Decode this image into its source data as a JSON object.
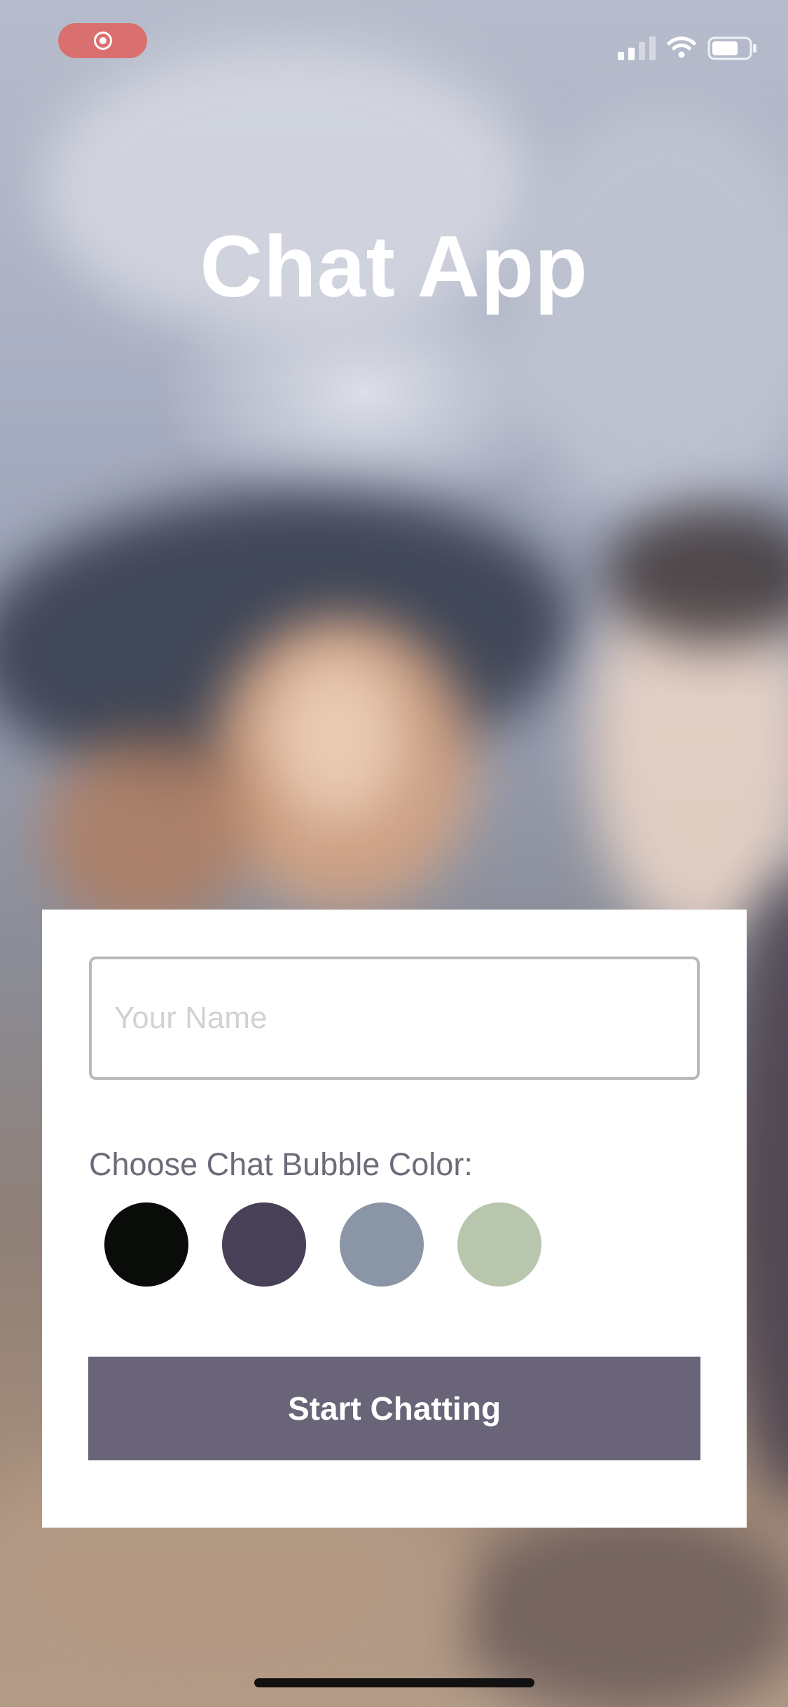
{
  "status_bar": {
    "recording_icon": "screen-record-icon",
    "signal_icon": "cellular-signal-icon",
    "wifi_icon": "wifi-icon",
    "battery_icon": "battery-icon"
  },
  "app": {
    "title": "Chat App"
  },
  "form": {
    "name_placeholder": "Your Name",
    "name_value": "",
    "color_label": "Choose Chat Bubble Color:",
    "colors": [
      "#090C08",
      "#474056",
      "#8A95A5",
      "#B9C6AE"
    ],
    "start_label": "Start Chatting"
  },
  "theme": {
    "button_color": "#6a6479",
    "record_pill_color": "#d9706f"
  }
}
